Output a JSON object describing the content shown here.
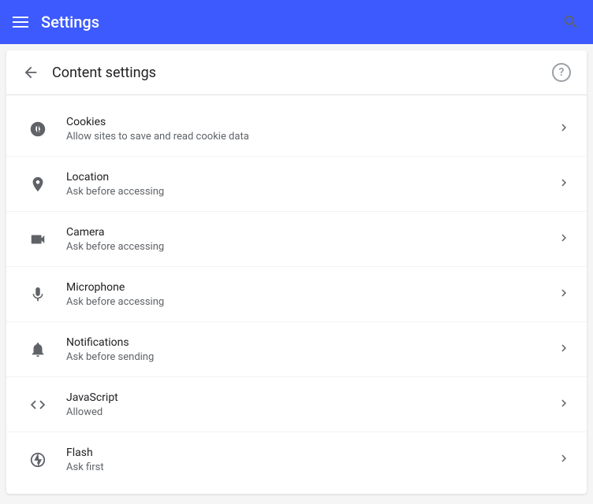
{
  "header": {
    "title": "Settings",
    "search_label": "Search"
  },
  "subheader": {
    "back_label": "Back",
    "page_title": "Content settings",
    "help_label": "?"
  },
  "items": [
    {
      "id": "cookies",
      "title": "Cookies",
      "subtitle": "Allow sites to save and read cookie data",
      "icon": "cookies"
    },
    {
      "id": "location",
      "title": "Location",
      "subtitle": "Ask before accessing",
      "icon": "location"
    },
    {
      "id": "camera",
      "title": "Camera",
      "subtitle": "Ask before accessing",
      "icon": "camera"
    },
    {
      "id": "microphone",
      "title": "Microphone",
      "subtitle": "Ask before accessing",
      "icon": "microphone"
    },
    {
      "id": "notifications",
      "title": "Notifications",
      "subtitle": "Ask before sending",
      "icon": "notifications"
    },
    {
      "id": "javascript",
      "title": "JavaScript",
      "subtitle": "Allowed",
      "icon": "javascript"
    },
    {
      "id": "flash",
      "title": "Flash",
      "subtitle": "Ask first",
      "icon": "flash"
    }
  ]
}
